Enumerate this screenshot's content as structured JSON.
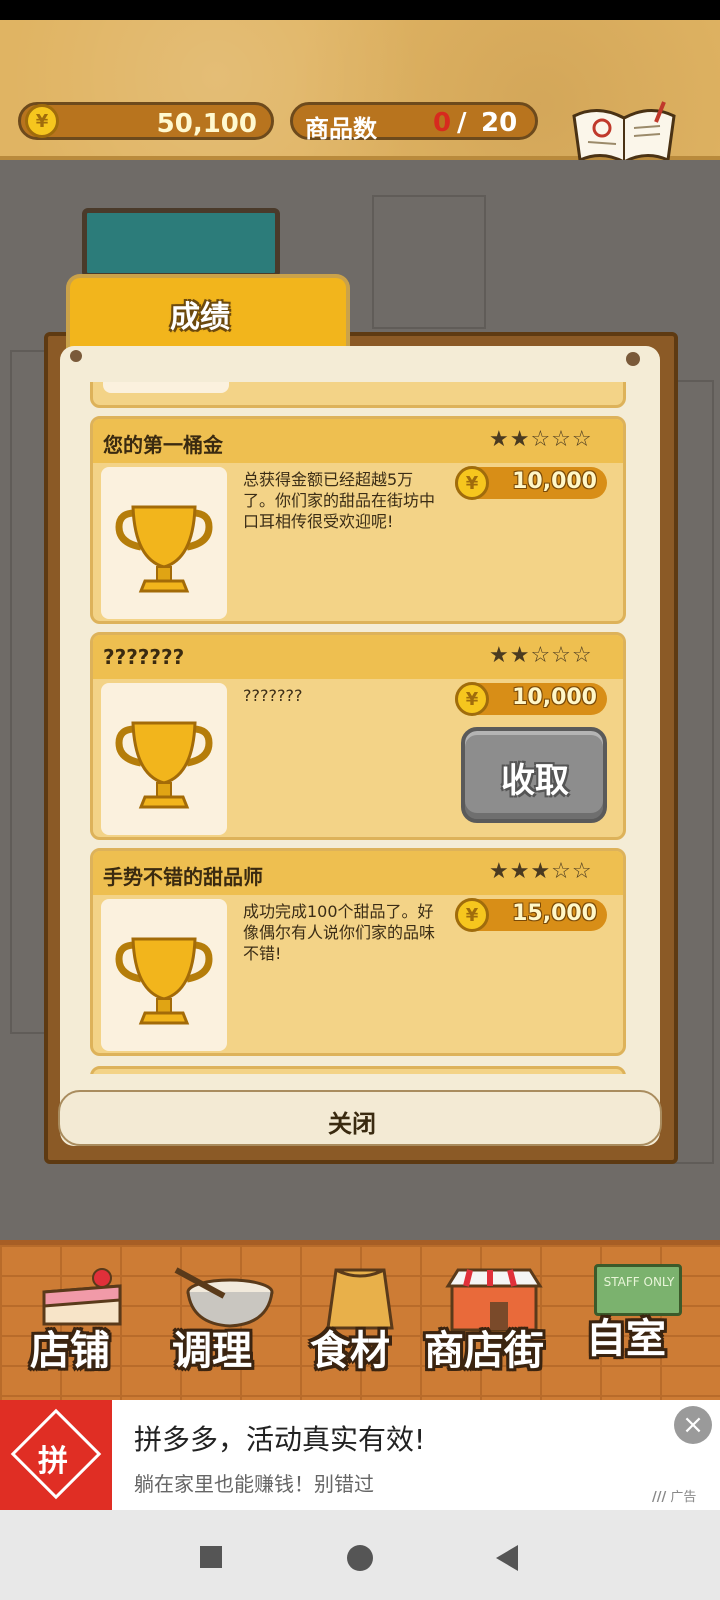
{
  "header": {
    "coins": "50,100",
    "coin_symbol": "¥",
    "goods_label": "商品数",
    "goods_count": "0",
    "goods_separator": "/",
    "goods_max": "20",
    "recipe_label": "食谱"
  },
  "panel": {
    "tab_title": "成绩",
    "close_label": "关闭",
    "achievements": [
      {
        "title": "您的第一桶金",
        "stars": "★★☆☆☆",
        "description": "总获得金额已经超越5万了。你们家的甜品在街坊中口耳相传很受欢迎呢!",
        "reward": "10,000"
      },
      {
        "title": "???????",
        "stars": "★★☆☆☆",
        "description": "???????",
        "reward": "10,000",
        "button_label": "收取"
      },
      {
        "title": "手势不错的甜品师",
        "stars": "★★★☆☆",
        "description": "成功完成100个甜品了。好像偶尔有人说你们家的品味不错!",
        "reward": "15,000"
      }
    ]
  },
  "bottom_nav": {
    "items": [
      {
        "label": "店铺"
      },
      {
        "label": "调理"
      },
      {
        "label": "食材"
      },
      {
        "label": "商店街"
      },
      {
        "label": "自室"
      }
    ],
    "staff_sign": "STAFF ONLY"
  },
  "ad": {
    "logo_text": "拼",
    "title": "拼多多，活动真实有效!",
    "subtitle": "躺在家里也能赚钱！别错过",
    "badge": "广告",
    "close_icon": "×"
  },
  "colors": {
    "accent": "#f2b51c",
    "card": "#f3d387",
    "reward_pill": "#d88e17",
    "ad_red": "#e02e24"
  }
}
